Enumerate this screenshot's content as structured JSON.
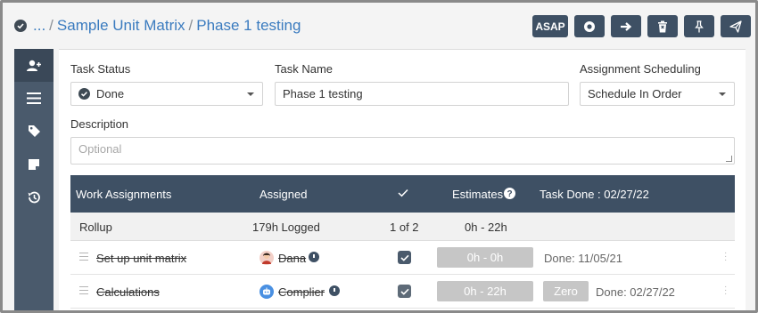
{
  "header": {
    "breadcrumb": {
      "ellipsis": "...",
      "separator": "/",
      "parent": "Sample Unit Matrix",
      "current": "Phase 1 testing"
    },
    "toolbar": {
      "asap_label": "ASAP",
      "icons": [
        "record-icon",
        "arrow-right-icon",
        "trash-icon",
        "pin-icon",
        "send-icon"
      ]
    }
  },
  "sidebar": {
    "items": [
      "add-user-icon",
      "list-icon",
      "tag-icon",
      "note-icon",
      "history-icon"
    ]
  },
  "form": {
    "task_status": {
      "label": "Task Status",
      "value": "Done"
    },
    "task_name": {
      "label": "Task Name",
      "value": "Phase 1 testing"
    },
    "assignment_scheduling": {
      "label": "Assignment Scheduling",
      "value": "Schedule In Order"
    },
    "description": {
      "label": "Description",
      "placeholder": "Optional"
    }
  },
  "table": {
    "headers": {
      "work_assignments": "Work Assignments",
      "assigned": "Assigned",
      "estimates": "Estimates",
      "task_done": "Task Done : 02/27/22"
    },
    "rollup": {
      "label": "Rollup",
      "logged": "179h Logged",
      "count": "1 of 2",
      "range": "0h - 22h"
    },
    "rows": [
      {
        "name": "Set up unit matrix",
        "assignee": "Dana",
        "estimate": "0h - 0h",
        "zero_label": "",
        "done": "Done: 11/05/21"
      },
      {
        "name": "Calculations",
        "assignee": "Complier",
        "estimate": "0h - 22h",
        "zero_label": "Zero",
        "done": "Done: 02/27/22"
      }
    ]
  },
  "colors": {
    "accent": "#3a7bbf",
    "navy": "#3e5064",
    "sidebar": "#4a5a6c"
  }
}
